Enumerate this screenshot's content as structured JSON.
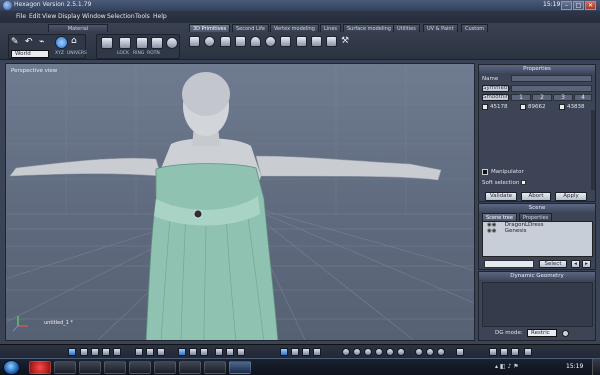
{
  "window": {
    "title": "Hexagon Version 2.5.1.79",
    "clock": "15:19",
    "controls": [
      "–",
      "□",
      "✕"
    ]
  },
  "menu": [
    "File",
    "Edit",
    "View",
    "Display",
    "Window",
    "Selection",
    "Tools",
    "Help"
  ],
  "toolbar": {
    "material_label": "Material",
    "world_dropdown": "World",
    "coord_labels": [
      "XYZ",
      "UNIVERS"
    ],
    "lock_labels": [
      "LOCK",
      "RING",
      "ROTN"
    ],
    "tabs": [
      "3D Primitives",
      "Second Life",
      "Vertex modeling",
      "Lines",
      "Surface modeling",
      "Utilities",
      "UV & Paint",
      "Custom"
    ],
    "active_tab": "3D Primitives"
  },
  "viewport": {
    "label": "Perspective view",
    "object_label": "untitled_1 *"
  },
  "properties": {
    "header": "Properties",
    "name_label": "Name",
    "name_value": "",
    "symmetry_label": "Symmetry",
    "smoothing_label": "Smoothing",
    "smooth_levels": [
      "1",
      "2",
      "3",
      "4"
    ],
    "counts": [
      "45178",
      "89662",
      "43838"
    ],
    "manipulator_label": "Manipulator",
    "soft_selection_label": "Soft selection",
    "validate": "Validate",
    "abort": "Abort",
    "apply": "Apply"
  },
  "scene": {
    "header": "Scene",
    "tabs": [
      "Scene tree",
      "Properties"
    ],
    "items": [
      "DragonLDress",
      "Genesis"
    ],
    "select_button": "Select"
  },
  "dynamic_geometry": {
    "header": "Dynamic Geometry",
    "mode_label": "DG mode:",
    "mode_value": "Restric"
  },
  "taskbar": {
    "clock": "15:19"
  },
  "colors": {
    "accent": "#2d74d1",
    "viewport_bg": "#66728a",
    "panel_bg": "#3c4455",
    "dress": "#8fc2b0",
    "skin": "#c8cbd0"
  }
}
